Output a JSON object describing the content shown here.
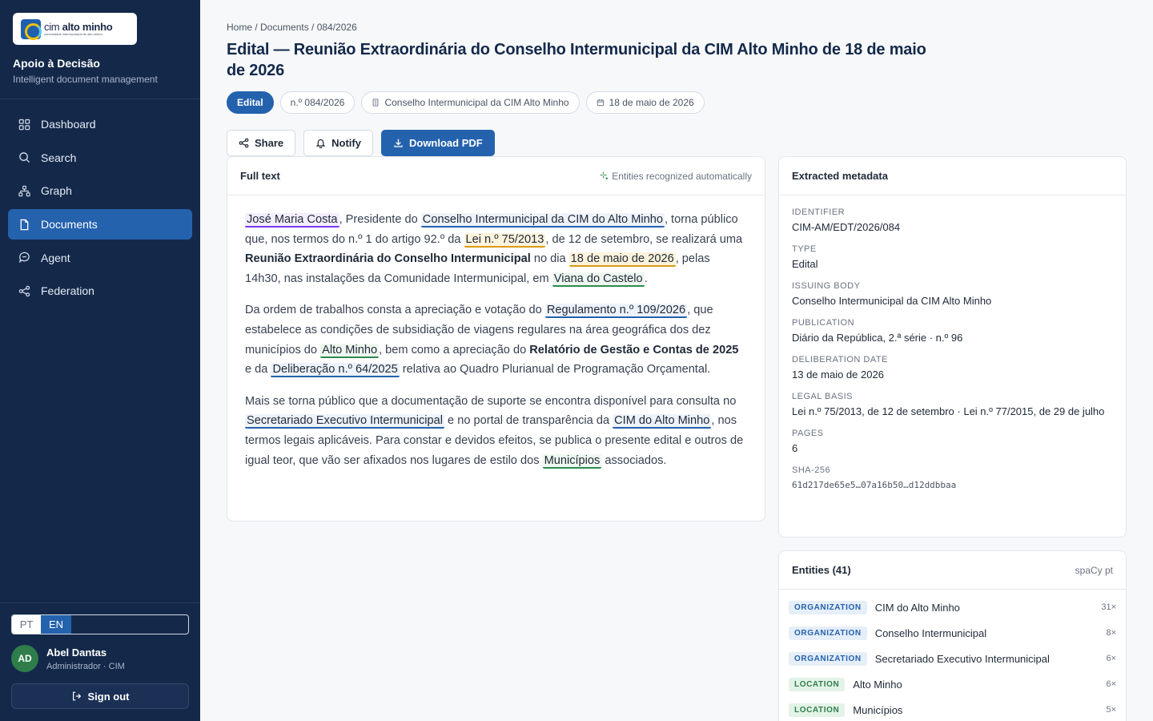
{
  "sidebar": {
    "logo": {
      "line1_light": "cim ",
      "line1_bold": "alto minho",
      "line2": "comunidade intermunicipal do alto minho"
    },
    "app_title": "Apoio à Decisão",
    "app_subtitle": "Intelligent document management",
    "nav": [
      {
        "label": "Dashboard",
        "icon": "grid-icon"
      },
      {
        "label": "Search",
        "icon": "search-icon"
      },
      {
        "label": "Graph",
        "icon": "graph-icon"
      },
      {
        "label": "Documents",
        "icon": "document-icon",
        "active": true
      },
      {
        "label": "Agent",
        "icon": "chat-icon"
      },
      {
        "label": "Federation",
        "icon": "share-icon"
      }
    ],
    "lang": {
      "pt": "PT",
      "en": "EN",
      "selected": "EN"
    },
    "user": {
      "initials": "AD",
      "name": "Abel Dantas",
      "role": "Administrador · CIM"
    },
    "signout": "Sign out"
  },
  "header": {
    "breadcrumb": "Home / Documents / 084/2026",
    "title": "Edital — Reunião Extraordinária do Conselho Intermunicipal da CIM Alto Minho de 18 de maio de 2026",
    "chips": {
      "type": "Edital",
      "number": "n.º 084/2026",
      "body": "Conselho Intermunicipal da CIM Alto Minho",
      "date": "18 de maio de 2026"
    },
    "actions": {
      "share": "Share",
      "notify": "Notify",
      "download": "Download PDF"
    }
  },
  "fulltext": {
    "title": "Full text",
    "note": "Entities recognized automatically",
    "p1": {
      "e1": "José Maria Costa",
      "t1": ", Presidente do ",
      "e2": "Conselho Intermunicipal da CIM do Alto Minho",
      "t2": ", torna público que, nos termos do n.º 1 do artigo 92.º da ",
      "e3": "Lei n.º 75/2013",
      "t3": ", de 12 de setembro, se realizará uma ",
      "b1": "Reunião Extraordinária do Conselho Intermunicipal",
      "t4": " no dia ",
      "e4": "18 de maio de 2026",
      "t5": ", pelas 14h30, nas instalações da Comunidade Intermunicipal, em ",
      "e5": "Viana do Castelo",
      "t6": "."
    },
    "p2": {
      "t1": "Da ordem de trabalhos consta a apreciação e votação do ",
      "e1": "Regulamento n.º 109/2026",
      "t2": ", que estabelece as condições de subsidiação de viagens regulares na área geográfica dos dez municípios do ",
      "e2": "Alto Minho",
      "t3": ", bem como a apreciação do ",
      "b1": "Relatório de Gestão e Contas de 2025",
      "t4": " e da ",
      "e3": "Deliberação n.º 64/2025",
      "t5": " relativa ao Quadro Plurianual de Programação Orçamental."
    },
    "p3": {
      "t1": "Mais se torna público que a documentação de suporte se encontra disponível para consulta no ",
      "e1": "Secretariado Executivo Intermunicipal",
      "t2": " e no portal de transparência da ",
      "e2": "CIM do Alto Minho",
      "t3": ", nos termos legais aplicáveis. Para constar e devidos efeitos, se publica o presente edital e outros de igual teor, que vão ser afixados nos lugares de estilo dos ",
      "e3": "Municípios",
      "t4": " associados."
    }
  },
  "metadata": {
    "title": "Extracted metadata",
    "rows": [
      {
        "label": "IDENTIFIER",
        "value": "CIM-AM/EDT/2026/084"
      },
      {
        "label": "TYPE",
        "value": "Edital"
      },
      {
        "label": "ISSUING BODY",
        "value": "Conselho Intermunicipal da CIM Alto Minho"
      },
      {
        "label": "PUBLICATION",
        "value": "Diário da República, 2.ª série · n.º 96"
      },
      {
        "label": "DELIBERATION DATE",
        "value": "13 de maio de 2026"
      },
      {
        "label": "LEGAL BASIS",
        "value": "Lei n.º 75/2013, de 12 de setembro · Lei n.º 77/2015, de 29 de julho"
      },
      {
        "label": "PAGES",
        "value": "6"
      },
      {
        "label": "SHA-256",
        "value": "61d217de65e5…07a16b50…d12ddbbaa"
      }
    ]
  },
  "entities": {
    "title": "Entities (41)",
    "engine": "spaCy pt",
    "items": [
      {
        "type": "ORGANIZATION",
        "name": "CIM do Alto Minho",
        "count": "31×"
      },
      {
        "type": "ORGANIZATION",
        "name": "Conselho Intermunicipal",
        "count": "8×"
      },
      {
        "type": "ORGANIZATION",
        "name": "Secretariado Executivo Intermunicipal",
        "count": "6×"
      },
      {
        "type": "LOCATION",
        "name": "Alto Minho",
        "count": "6×"
      },
      {
        "type": "LOCATION",
        "name": "Municípios",
        "count": "5×"
      }
    ]
  }
}
